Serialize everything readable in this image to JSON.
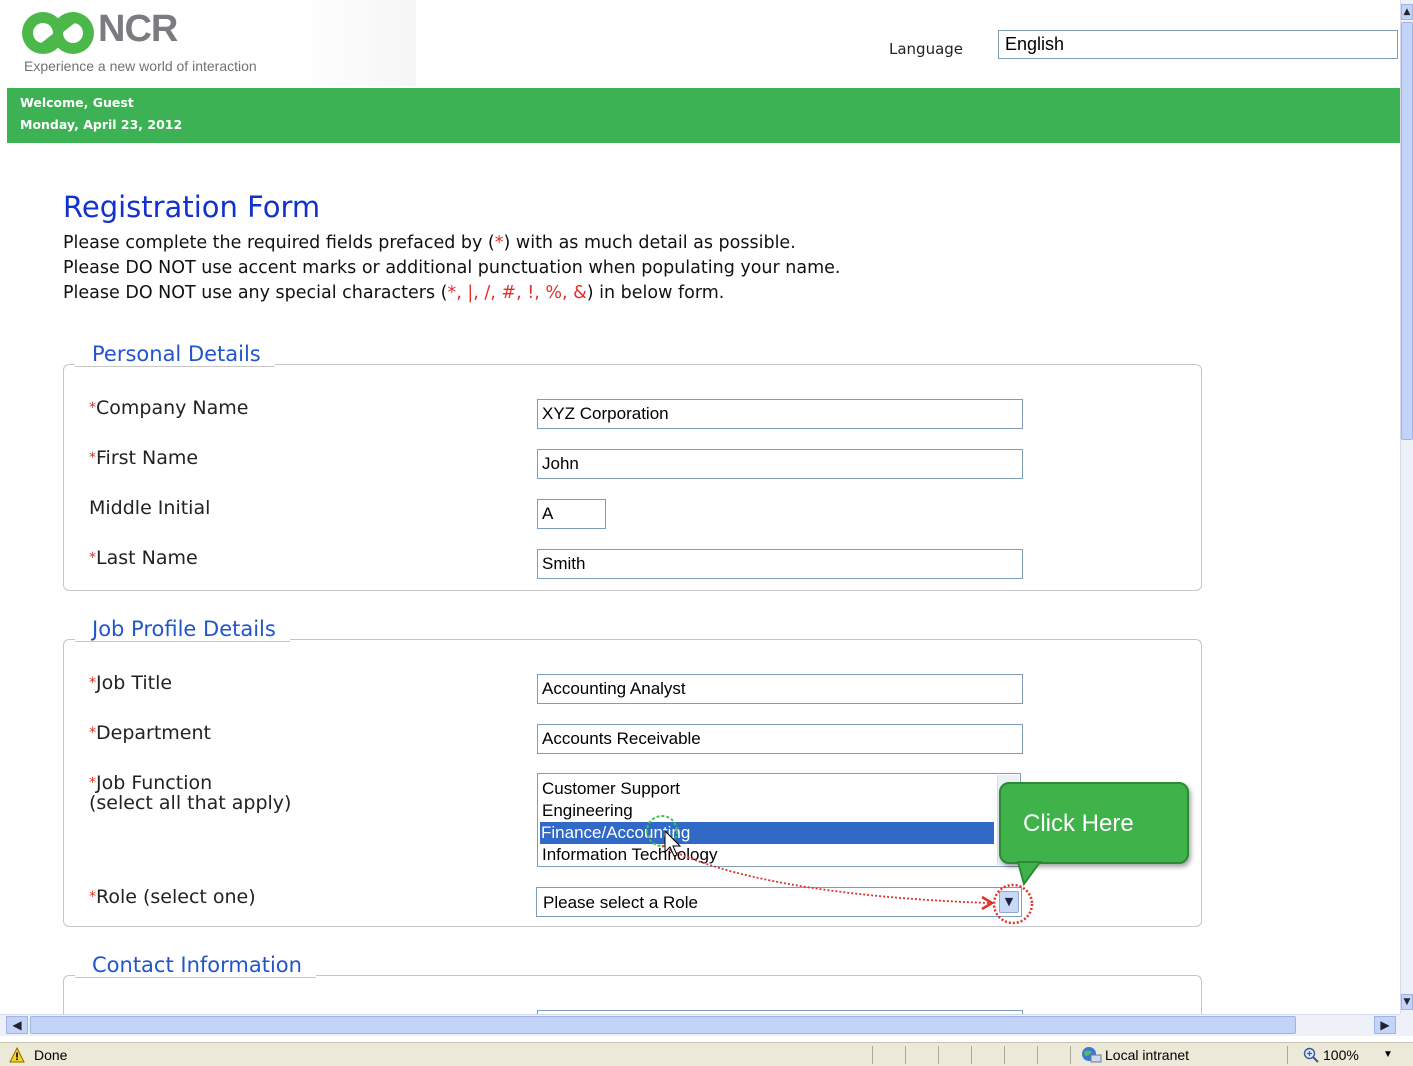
{
  "header": {
    "logo_text": "NCR",
    "tagline": "Experience a new world of interaction",
    "language_label": "Language",
    "language_value": "English"
  },
  "welcome": {
    "greeting": "Welcome, Guest",
    "date": "Monday, April 23, 2012"
  },
  "form": {
    "title": "Registration Form",
    "intro1_a": "Please complete the required fields prefaced by (",
    "intro1_star": "*",
    "intro1_b": ") with as much detail as possible.",
    "intro2": "Please DO NOT use accent marks or additional punctuation when populating your name.",
    "intro3_a": "Please DO NOT use any special characters (",
    "intro3_chars": "*, |, /, #, !, %, &",
    "intro3_b": ") in below form.",
    "required_mark": "*"
  },
  "personal": {
    "legend": "Personal Details",
    "company_label": "Company Name",
    "company_value": "XYZ Corporation",
    "first_label": "First Name",
    "first_value": "John",
    "middle_label": "Middle Initial",
    "middle_value": "A",
    "last_label": "Last Name",
    "last_value": "Smith"
  },
  "job": {
    "legend": "Job Profile Details",
    "title_label": "Job Title",
    "title_value": "Accounting Analyst",
    "dept_label": "Department",
    "dept_value": "Accounts Receivable",
    "function_label": "Job Function",
    "function_sub": "(select all that apply)",
    "function_options": [
      "Customer Support",
      "Engineering",
      "Finance/Accounting",
      "Information Technology"
    ],
    "function_selected": "Finance/Accounting",
    "role_label": "Role (select one)",
    "role_value": "Please select a Role"
  },
  "contact": {
    "legend": "Contact Information"
  },
  "callout": {
    "text": "Click Here"
  },
  "statusbar": {
    "status": "Done",
    "zone": "Local intranet",
    "zoom": "100%"
  },
  "colors": {
    "brand_green": "#3cb254",
    "title_blue": "#1133cc",
    "legend_blue": "#2255cc",
    "required_red": "#e0302a",
    "selection_blue": "#3169c6"
  },
  "icons": [
    "ncr-logo-icon",
    "dropdown-arrow-icon",
    "warning-icon",
    "globe-icon",
    "zoom-icon",
    "mouse-cursor-icon"
  ]
}
